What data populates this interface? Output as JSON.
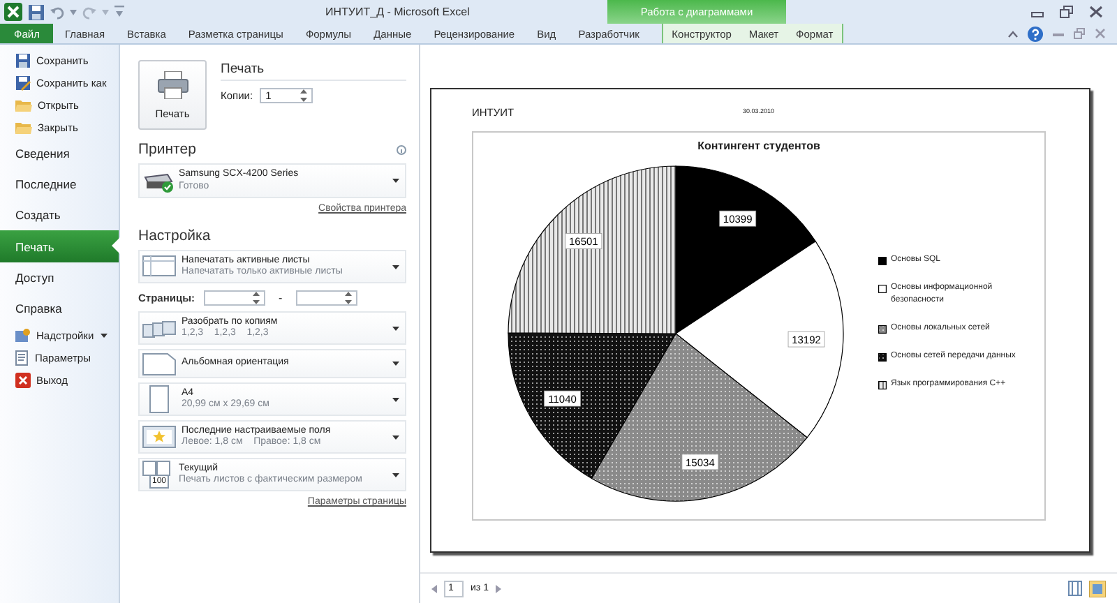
{
  "window": {
    "title": "ИНТУИТ_Д - Microsoft Excel"
  },
  "ribbon": {
    "tabs": [
      {
        "label": "Файл",
        "selected": true
      },
      {
        "label": "Главная",
        "selected": false
      },
      {
        "label": "Вставка",
        "selected": false
      },
      {
        "label": "Разметка страницы",
        "selected": false
      },
      {
        "label": "Формулы",
        "selected": false
      },
      {
        "label": "Данные",
        "selected": false
      },
      {
        "label": "Рецензирование",
        "selected": false
      },
      {
        "label": "Вид",
        "selected": false
      },
      {
        "label": "Разработчик",
        "selected": false
      }
    ],
    "contextual": {
      "title": "Работа с диаграммами",
      "tabs": [
        {
          "label": "Конструктор",
          "selected": false
        },
        {
          "label": "Макет",
          "selected": false
        },
        {
          "label": "Формат",
          "selected": false
        }
      ]
    }
  },
  "nav": {
    "items": [
      {
        "label": "Сохранить",
        "kind": "save",
        "selected": false
      },
      {
        "label": "Сохранить как",
        "kind": "saveas",
        "selected": false
      },
      {
        "label": "Открыть",
        "kind": "open",
        "selected": false
      },
      {
        "label": "Закрыть",
        "kind": "close",
        "selected": false
      },
      {
        "label": "Сведения",
        "kind": "page",
        "selected": false
      },
      {
        "label": "Последние",
        "kind": "page",
        "selected": false
      },
      {
        "label": "Создать",
        "kind": "page",
        "selected": false
      },
      {
        "label": "Печать",
        "kind": "page",
        "selected": true
      },
      {
        "label": "Доступ",
        "kind": "page",
        "selected": false
      },
      {
        "label": "Справка",
        "kind": "page",
        "selected": false
      },
      {
        "label": "Надстройки",
        "kind": "addins",
        "selected": false,
        "menu": true
      },
      {
        "label": "Параметры",
        "kind": "options",
        "selected": false
      },
      {
        "label": "Выход",
        "kind": "exit",
        "selected": false
      }
    ]
  },
  "print": {
    "button": "Печать",
    "heading": "Печать",
    "copies_label": "Копии:",
    "copies": "1"
  },
  "printer": {
    "heading": "Принтер",
    "name": "Samsung SCX-4200 Series",
    "status": "Готово",
    "link": "Свойства принтера"
  },
  "settings": {
    "heading": "Настройка",
    "items": [
      {
        "kind": "sheets",
        "title": "Напечатать активные листы",
        "subtitle": "Напечатать только активные листы"
      },
      {
        "kind": "range",
        "label": "Страницы:",
        "separator": "-"
      },
      {
        "kind": "collate",
        "title": "Разобрать по копиям",
        "subtitle": "1,2,3    1,2,3    1,2,3"
      },
      {
        "kind": "orientation",
        "title": "Альбомная ориентация"
      },
      {
        "kind": "paper",
        "title": "A4",
        "subtitle": "20,99 см x 29,69 см"
      },
      {
        "kind": "margins",
        "title": "Последние настраиваемые поля",
        "subtitle": "Левое: 1,8 см    Правое: 1,8 см"
      },
      {
        "kind": "scaling",
        "title": "Текущий",
        "subtitle": "Печать листов с фактическим размером",
        "icon_text": "100"
      }
    ],
    "link": "Параметры страницы"
  },
  "preview": {
    "header_left": "ИНТУИТ",
    "header_center": "30.03.2010",
    "chart_data": {
      "type": "pie",
      "title": "Контингент студентов",
      "data_labels": true,
      "legend": true,
      "categories": [
        "Основы SQL",
        "Основы информационной безопасности",
        "Основы локальных сетей",
        "Основы сетей передачи данных",
        "Язык программирования C++"
      ],
      "values": [
        10399,
        13192,
        15034,
        11040,
        16501
      ]
    },
    "page": "1",
    "page_of": "из 1"
  }
}
